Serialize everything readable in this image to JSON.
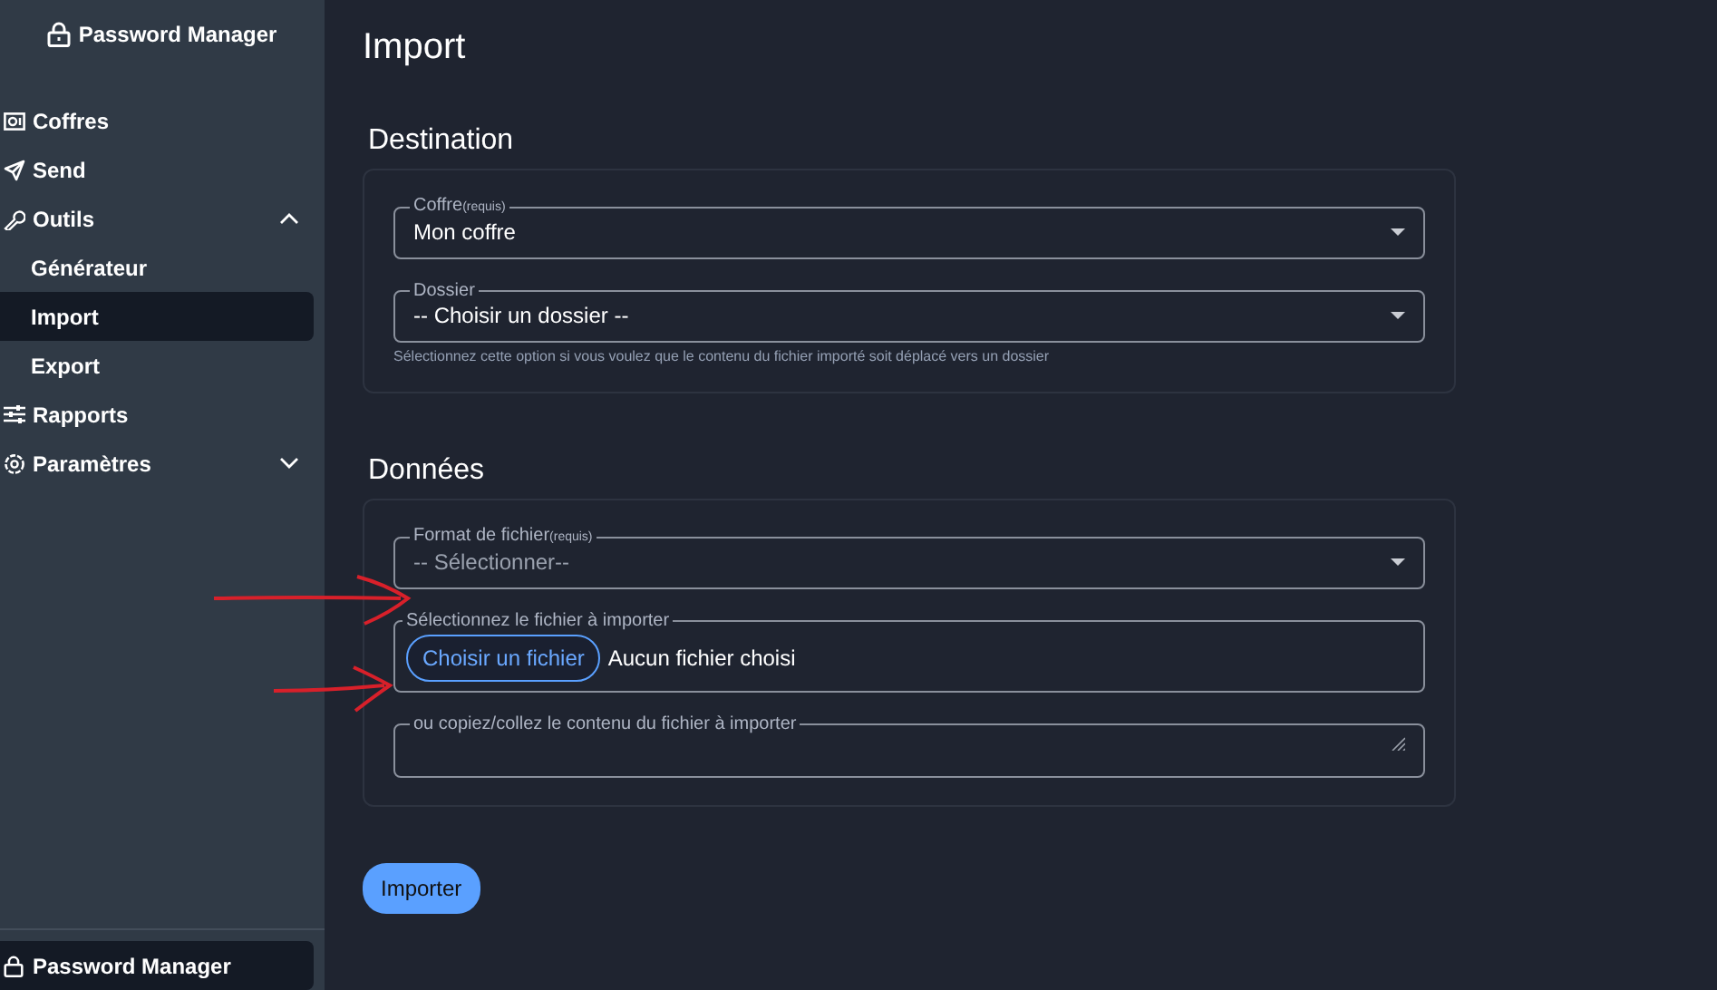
{
  "sidebar": {
    "app_title": "Password Manager",
    "items": [
      {
        "label": "Coffres",
        "selected": false
      },
      {
        "label": "Send",
        "selected": false
      },
      {
        "label": "Outils",
        "selected": false,
        "expanded": true,
        "children": [
          {
            "label": "Générateur",
            "selected": false
          },
          {
            "label": "Import",
            "selected": true
          },
          {
            "label": "Export",
            "selected": false
          }
        ]
      },
      {
        "label": "Rapports",
        "selected": false
      },
      {
        "label": "Paramètres",
        "selected": false,
        "expanded": false
      }
    ],
    "footer": "Password Manager"
  },
  "page_title": "Import",
  "sections": [
    {
      "heading": "Destination",
      "fields": [
        {
          "kind": "select",
          "label": "Coffre",
          "required_note": "(requis)",
          "value": "Mon coffre"
        },
        {
          "kind": "select",
          "label": "Dossier",
          "value": "-- Choisir un dossier --",
          "hint": "Sélectionnez cette option si vous voulez que le contenu du fichier importé soit déplacé vers un dossier"
        }
      ]
    },
    {
      "heading": "Données",
      "fields": [
        {
          "kind": "select",
          "label": "Format de fichier",
          "required_note": "(requis)",
          "placeholder": "-- Sélectionner--"
        },
        {
          "kind": "file",
          "label": "Sélectionnez le fichier à importer",
          "button": "Choisir un fichier",
          "status": "Aucun fichier choisi"
        },
        {
          "kind": "textarea",
          "label": "ou copiez/collez le contenu du fichier à importer"
        }
      ]
    }
  ],
  "submit": "Importer"
}
